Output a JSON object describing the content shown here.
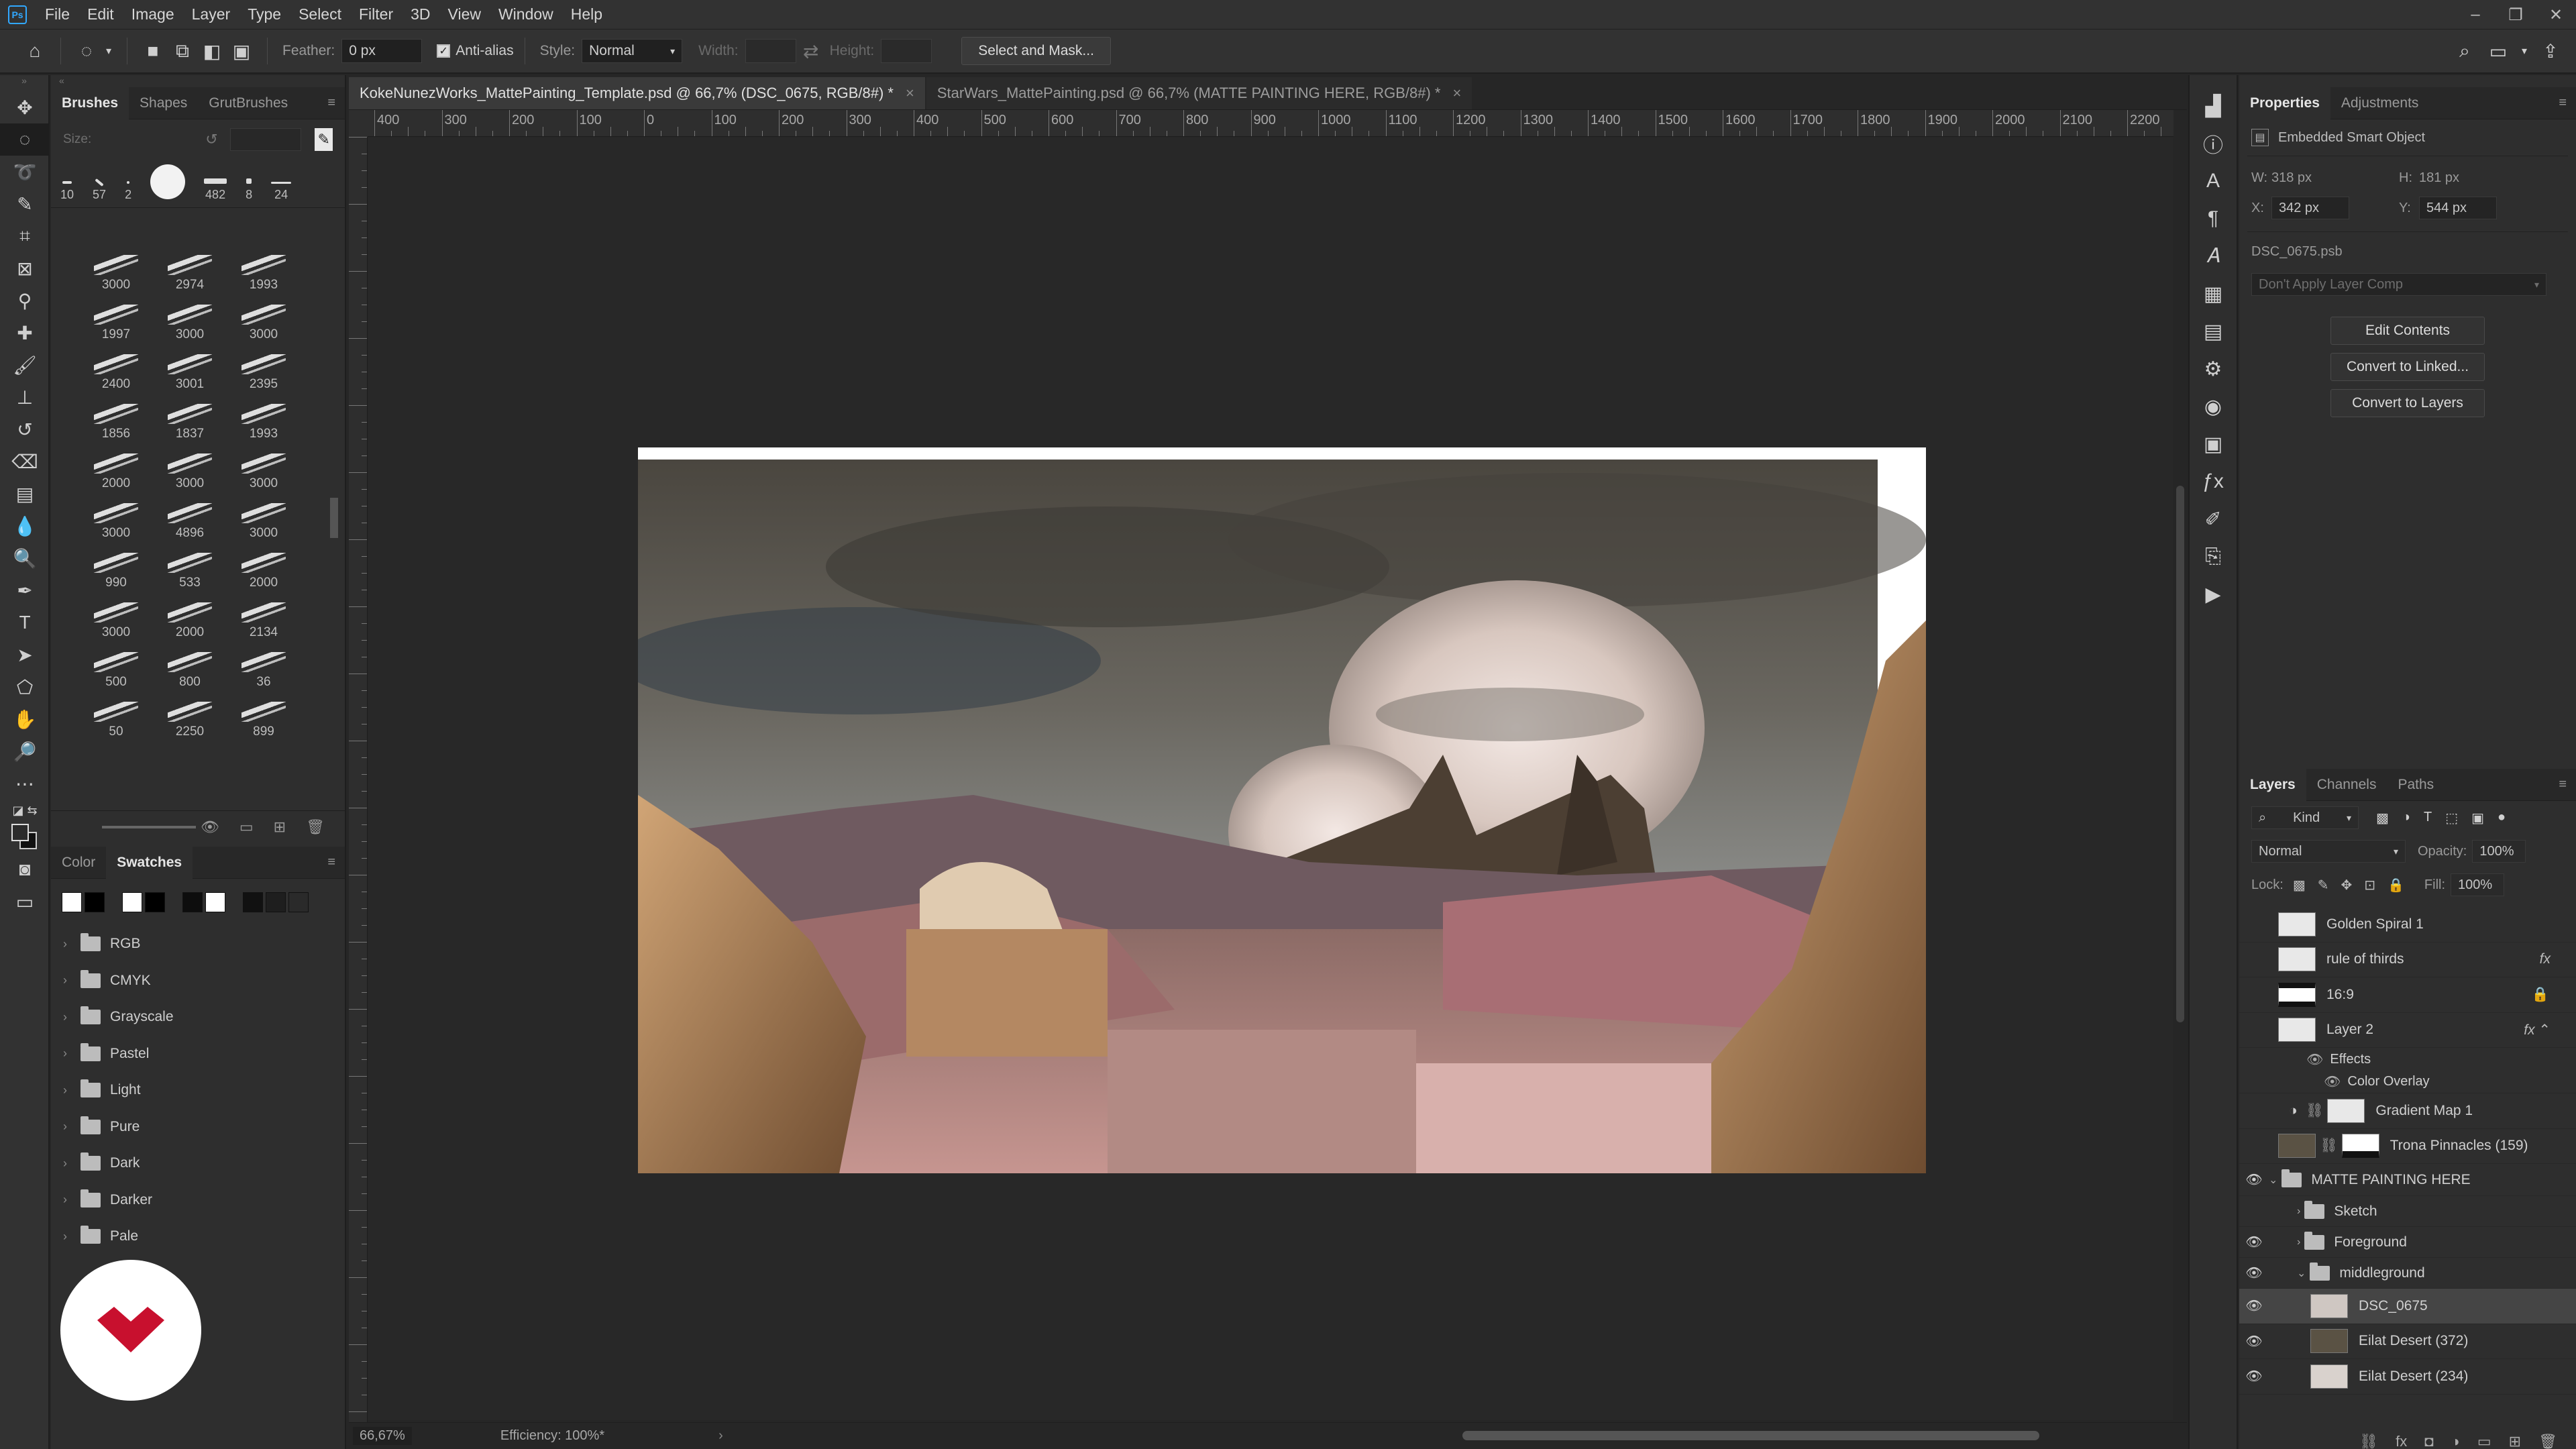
{
  "menubar": {
    "items": [
      "File",
      "Edit",
      "Image",
      "Layer",
      "Type",
      "Select",
      "Filter",
      "3D",
      "View",
      "Window",
      "Help"
    ]
  },
  "options": {
    "feather_label": "Feather:",
    "feather_value": "0 px",
    "antialias_label": "Anti-alias",
    "style_label": "Style:",
    "style_value": "Normal",
    "width_label": "Width:",
    "height_label": "Height:",
    "select_mask_label": "Select and Mask..."
  },
  "brushes_panel": {
    "tabs": [
      "Brushes",
      "Shapes",
      "GrutBrushes"
    ],
    "size_label": "Size:",
    "presets": [
      "10",
      "57",
      "2",
      "",
      "482",
      "8",
      "24"
    ],
    "grid": [
      "3000",
      "2974",
      "1993",
      "1997",
      "3000",
      "3000",
      "2400",
      "3001",
      "2395",
      "1856",
      "1837",
      "1993",
      "2000",
      "3000",
      "3000",
      "3000",
      "4896",
      "3000",
      "990",
      "533",
      "2000",
      "3000",
      "2000",
      "2134",
      "500",
      "800",
      "36",
      "50",
      "2250",
      "899"
    ]
  },
  "swatches_panel": {
    "tabs": [
      "Color",
      "Swatches"
    ],
    "groups": [
      "RGB",
      "CMYK",
      "Grayscale",
      "Pastel",
      "Light",
      "Pure",
      "Dark",
      "Darker",
      "Pale"
    ]
  },
  "documents": {
    "tabs": [
      {
        "title": "KokeNunezWorks_MattePainting_Template.psd @ 66,7% (DSC_0675, RGB/8#) *",
        "active": true
      },
      {
        "title": "StarWars_MattePainting.psd @ 66,7% (MATTE PAINTING HERE, RGB/8#) *",
        "active": false
      }
    ],
    "ruler_labels": [
      "400",
      "300",
      "200",
      "100",
      "0",
      "100",
      "200",
      "300",
      "400",
      "500",
      "600",
      "700",
      "800",
      "900",
      "1000",
      "1100",
      "1200",
      "1300",
      "1400",
      "1500",
      "1600",
      "1700",
      "1800",
      "1900",
      "2000",
      "2100",
      "2200"
    ]
  },
  "status": {
    "zoom": "66,67%",
    "efficiency": "Efficiency: 100%*"
  },
  "properties": {
    "tabs": [
      "Properties",
      "Adjustments"
    ],
    "type": "Embedded Smart Object",
    "w_label": "W:",
    "w_value": "318 px",
    "h_label": "H:",
    "h_value": "181 px",
    "x_label": "X:",
    "x_value": "342 px",
    "y_label": "Y:",
    "y_value": "544 px",
    "filename": "DSC_0675.psb",
    "layer_comp": "Don't Apply Layer Comp",
    "buttons": [
      "Edit Contents",
      "Convert to Linked...",
      "Convert to Layers"
    ]
  },
  "layers_panel": {
    "tabs": [
      "Layers",
      "Channels",
      "Paths"
    ],
    "filter": "Kind",
    "blend_mode": "Normal",
    "opacity_label": "Opacity:",
    "opacity_value": "100%",
    "lock_label": "Lock:",
    "fill_label": "Fill:",
    "fill_value": "100%",
    "layers": [
      {
        "name": "Golden Spiral 1"
      },
      {
        "name": "rule of thirds"
      },
      {
        "name": "16:9"
      },
      {
        "name": "Layer 2"
      },
      {
        "name": "Effects"
      },
      {
        "name": "Color Overlay"
      },
      {
        "name": "Gradient Map 1"
      },
      {
        "name": "Trona Pinnacles (159)"
      },
      {
        "name": "MATTE PAINTING HERE"
      },
      {
        "name": "Sketch"
      },
      {
        "name": "Foreground"
      },
      {
        "name": "middleground"
      },
      {
        "name": "DSC_0675"
      },
      {
        "name": "Eilat Desert (372)"
      },
      {
        "name": "Eilat Desert (234)"
      }
    ]
  }
}
